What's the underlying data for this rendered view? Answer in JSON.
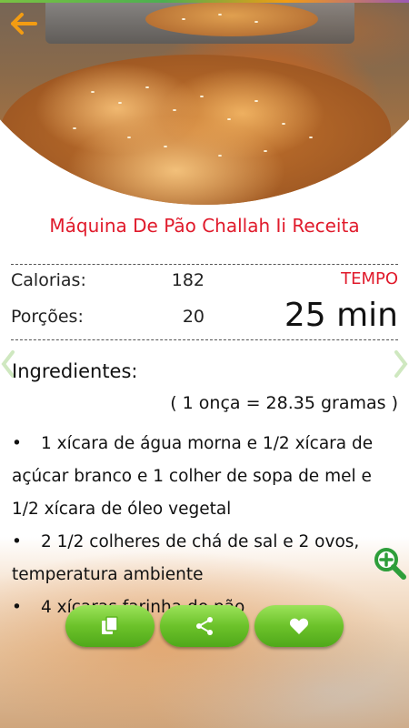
{
  "recipe": {
    "title": "Máquina De Pão Challah Ii Receita"
  },
  "stats": {
    "calories_label": "Calorias:",
    "calories_value": "182",
    "servings_label": "Porções:",
    "servings_value": "20",
    "time_label": "TEMPO",
    "time_value": "25 min"
  },
  "ingredients": {
    "heading": "Ingredientes:",
    "conversion": "( 1 onça = 28.35 gramas )",
    "bullet": "•",
    "items": [
      "1 xícara de água morna e 1/2 xícara de açúcar branco e 1 colher de sopa de mel e 1/2 xícara de óleo vegetal",
      "2 1/2 colheres de chá de sal e 2 ovos, temperatura ambiente",
      "4 xícaras farinha de pão"
    ]
  },
  "icons": {
    "back": "arrow-left-icon",
    "prev": "chevron-left-icon",
    "next": "chevron-right-icon",
    "zoom": "zoom-in-icon",
    "copy": "copy-icon",
    "share": "share-icon",
    "favorite": "heart-icon"
  },
  "colors": {
    "accent_red": "#e01a2b",
    "back_arrow": "#f39c12",
    "button_green": "#6cc22a",
    "zoom_green": "#2e9e3a"
  }
}
